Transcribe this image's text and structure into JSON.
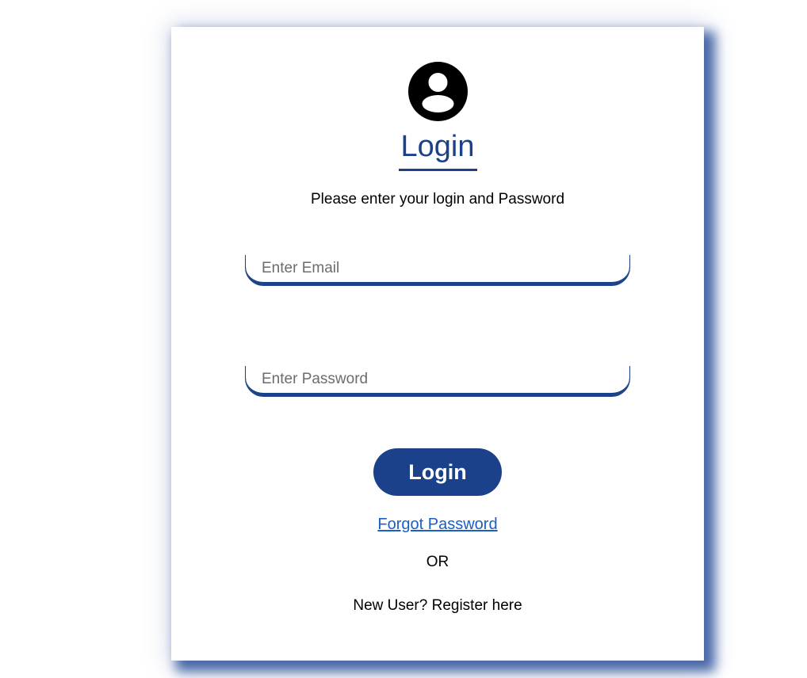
{
  "login_form": {
    "title": "Login",
    "subtitle": "Please enter your login and Password",
    "email_placeholder": "Enter Email",
    "password_placeholder": "Enter Password",
    "submit_label": "Login",
    "forgot_password_label": "Forgot Password",
    "or_label": "OR",
    "register_label": "New User? Register here",
    "icon": "user-circle-icon"
  },
  "colors": {
    "brand": "#1a4189",
    "link": "#1a5fc7",
    "background": "#ffffff",
    "shadow": "#4a68a8"
  }
}
